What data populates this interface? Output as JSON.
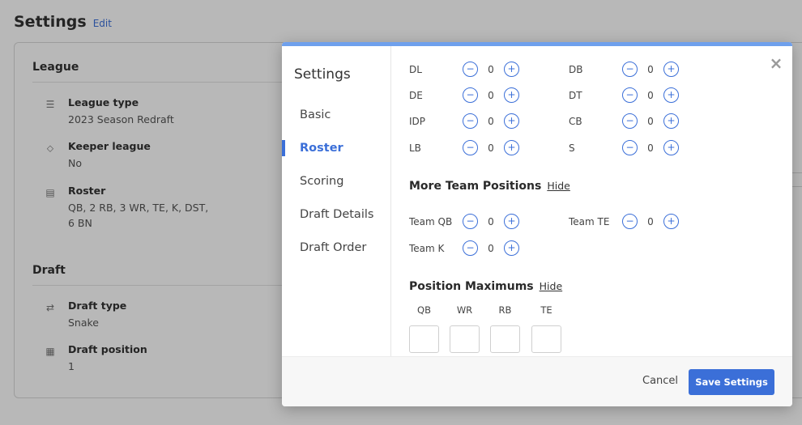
{
  "page": {
    "title": "Settings",
    "edit_label": "Edit"
  },
  "background": {
    "league": {
      "title": "League",
      "items": [
        {
          "label": "League type",
          "value": "2023 Season Redraft",
          "icon": "sliders-icon"
        },
        {
          "label": "Keeper league",
          "value": "No",
          "icon": "tag-icon"
        },
        {
          "label": "Roster",
          "value": "QB, 2 RB, 3 WR, TE, K, DST, 6 BN",
          "icon": "clipboard-icon"
        }
      ]
    },
    "draft": {
      "title": "Draft",
      "items": [
        {
          "label": "Draft type",
          "value": "Snake",
          "icon": "swap-icon"
        },
        {
          "label": "Draft position",
          "value": "1",
          "icon": "building-icon"
        }
      ]
    }
  },
  "modal": {
    "title": "Settings",
    "close_icon": "×",
    "nav": [
      {
        "label": "Basic",
        "active": false
      },
      {
        "label": "Roster",
        "active": true
      },
      {
        "label": "Scoring",
        "active": false
      },
      {
        "label": "Draft Details",
        "active": false
      },
      {
        "label": "Draft Order",
        "active": false
      }
    ],
    "idp_positions": [
      {
        "label": "DL",
        "value": "0"
      },
      {
        "label": "DB",
        "value": "0"
      },
      {
        "label": "DE",
        "value": "0"
      },
      {
        "label": "DT",
        "value": "0"
      },
      {
        "label": "IDP",
        "value": "0"
      },
      {
        "label": "CB",
        "value": "0"
      },
      {
        "label": "LB",
        "value": "0"
      },
      {
        "label": "S",
        "value": "0"
      }
    ],
    "more_team_positions": {
      "title": "More Team Positions",
      "hide_label": "Hide",
      "items": [
        {
          "label": "Team QB",
          "value": "0"
        },
        {
          "label": "Team TE",
          "value": "0"
        },
        {
          "label": "Team K",
          "value": "0"
        }
      ]
    },
    "position_maximums": {
      "title": "Position Maximums",
      "hide_label": "Hide",
      "columns": [
        {
          "label": "QB",
          "value": ""
        },
        {
          "label": "WR",
          "value": ""
        },
        {
          "label": "RB",
          "value": ""
        },
        {
          "label": "TE",
          "value": ""
        }
      ]
    },
    "stepper": {
      "minus": "−",
      "plus": "+"
    },
    "footer": {
      "cancel_label": "Cancel",
      "save_label": "Save Settings"
    }
  },
  "colors": {
    "accent": "#3b6fd8",
    "topbar": "#6fa0ec"
  }
}
